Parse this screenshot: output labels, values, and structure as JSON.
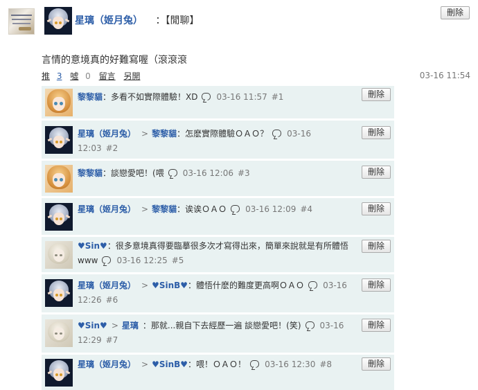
{
  "post": {
    "author": "星璃（姬月兔）",
    "category": "：【閒聊】",
    "content": "言情的意境真的好難寫喔（滾滾滾",
    "delete_label": "刪除",
    "stats": {
      "push_label": "推",
      "push_count": "3",
      "boo_label": "噓",
      "boo_count": "0",
      "reply_label": "留言",
      "share_label": "另開"
    },
    "time": "03-16 11:54"
  },
  "replies": [
    {
      "author": "黎黎貓",
      "text": "：多看不如實際體驗！XD",
      "time": "03-16 11:57",
      "floor": "#1",
      "delete_label": "刪除"
    },
    {
      "author": "星璃（姬月兔）",
      "target": "黎黎貓",
      "text": "：怎麽實際體驗ＯＡＯ？",
      "time_a": "03-16",
      "time_b": "12:03",
      "floor": "#2",
      "delete_label": "刪除"
    },
    {
      "author": "黎黎貓",
      "text": "：談戀愛吧！(喂",
      "time": "03-16 12:06",
      "floor": "#3",
      "delete_label": "刪除"
    },
    {
      "author": "星璃（姬月兔）",
      "target": "黎黎貓",
      "text": "：诶诶ＯＡＯ",
      "time": "03-16 12:09",
      "floor": "#4",
      "delete_label": "刪除"
    },
    {
      "author": "♥Sin♥",
      "text_a": "：很多意境真得要臨摹很多次才寫得出來，簡單來說就是有所體悟",
      "text_b": "www",
      "time": "03-16 12:25",
      "floor": "#5",
      "delete_label": "刪除"
    },
    {
      "author": "星璃（姬月兔）",
      "target": "♥SinB♥",
      "text": "：體悟什麽的難度更高啊ＯＡＯ",
      "time_a": "03-16",
      "time_b": "12:26",
      "floor": "#6",
      "delete_label": "刪除"
    },
    {
      "author": "♥Sin♥",
      "target": "星璃",
      "text": "：那就...親自下去經歷一遍 談戀愛吧！(笑)",
      "time_a": "03-16",
      "time_b": "12:29",
      "floor": "#7",
      "delete_label": "刪除"
    },
    {
      "author": "星璃（姬月兔）",
      "target": "♥SinB♥",
      "text": "：喂！ＯＡＯ！",
      "time": "03-16 12:30",
      "floor": "#8",
      "delete_label": "刪除"
    }
  ],
  "icons": {
    "reply_icon": "speech-bubble-icon",
    "arrow": ">"
  }
}
